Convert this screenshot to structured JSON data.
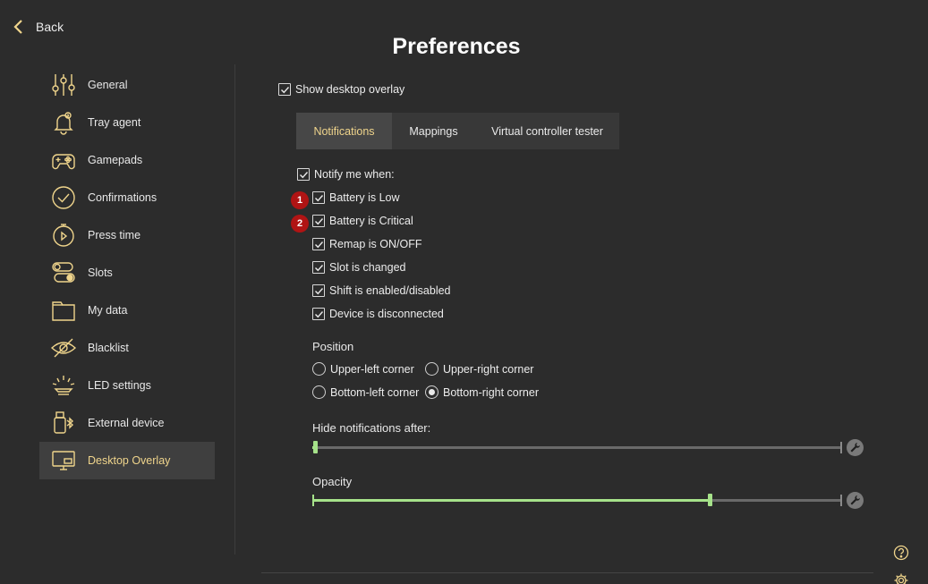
{
  "header": {
    "back_label": "Back",
    "title": "Preferences"
  },
  "sidebar": {
    "items": [
      {
        "id": "general",
        "label": "General",
        "icon": "sliders-icon"
      },
      {
        "id": "tray-agent",
        "label": "Tray agent",
        "icon": "bell-icon"
      },
      {
        "id": "gamepads",
        "label": "Gamepads",
        "icon": "gamepad-icon"
      },
      {
        "id": "confirmations",
        "label": "Confirmations",
        "icon": "check-circle-icon"
      },
      {
        "id": "press-time",
        "label": "Press time",
        "icon": "stopwatch-icon"
      },
      {
        "id": "slots",
        "label": "Slots",
        "icon": "toggle-icon"
      },
      {
        "id": "my-data",
        "label": "My data",
        "icon": "folder-icon"
      },
      {
        "id": "blacklist",
        "label": "Blacklist",
        "icon": "eye-slash-icon"
      },
      {
        "id": "led-settings",
        "label": "LED settings",
        "icon": "led-icon"
      },
      {
        "id": "external-device",
        "label": "External device",
        "icon": "usb-bluetooth-icon"
      },
      {
        "id": "desktop-overlay",
        "label": "Desktop Overlay",
        "icon": "monitor-icon",
        "active": true
      }
    ]
  },
  "main": {
    "show_overlay": {
      "label": "Show desktop overlay",
      "checked": true
    },
    "tabs": [
      {
        "label": "Notifications",
        "active": true
      },
      {
        "label": "Mappings",
        "active": false
      },
      {
        "label": "Virtual controller tester",
        "active": false
      }
    ],
    "notify": {
      "label": "Notify me when:",
      "checked": true,
      "options": [
        {
          "label": "Battery is Low",
          "checked": true,
          "badge": "1"
        },
        {
          "label": "Battery is Critical",
          "checked": true,
          "badge": "2"
        },
        {
          "label": "Remap is ON/OFF",
          "checked": true
        },
        {
          "label": "Slot is changed",
          "checked": true
        },
        {
          "label": "Shift is enabled/disabled",
          "checked": true
        },
        {
          "label": "Device is disconnected",
          "checked": true
        }
      ]
    },
    "position": {
      "label": "Position",
      "options": [
        {
          "label": "Upper-left corner",
          "selected": false
        },
        {
          "label": "Upper-right corner",
          "selected": false
        },
        {
          "label": "Bottom-left corner",
          "selected": false
        },
        {
          "label": "Bottom-right corner",
          "selected": true
        }
      ]
    },
    "hide_after": {
      "label": "Hide notifications after:",
      "value": 0.005
    },
    "opacity": {
      "label": "Opacity",
      "value": 0.75
    }
  },
  "colors": {
    "background": "#2c2c2c",
    "accent": "#f0d58c",
    "slider_fill": "#a6e28a",
    "badge": "#b01414"
  }
}
